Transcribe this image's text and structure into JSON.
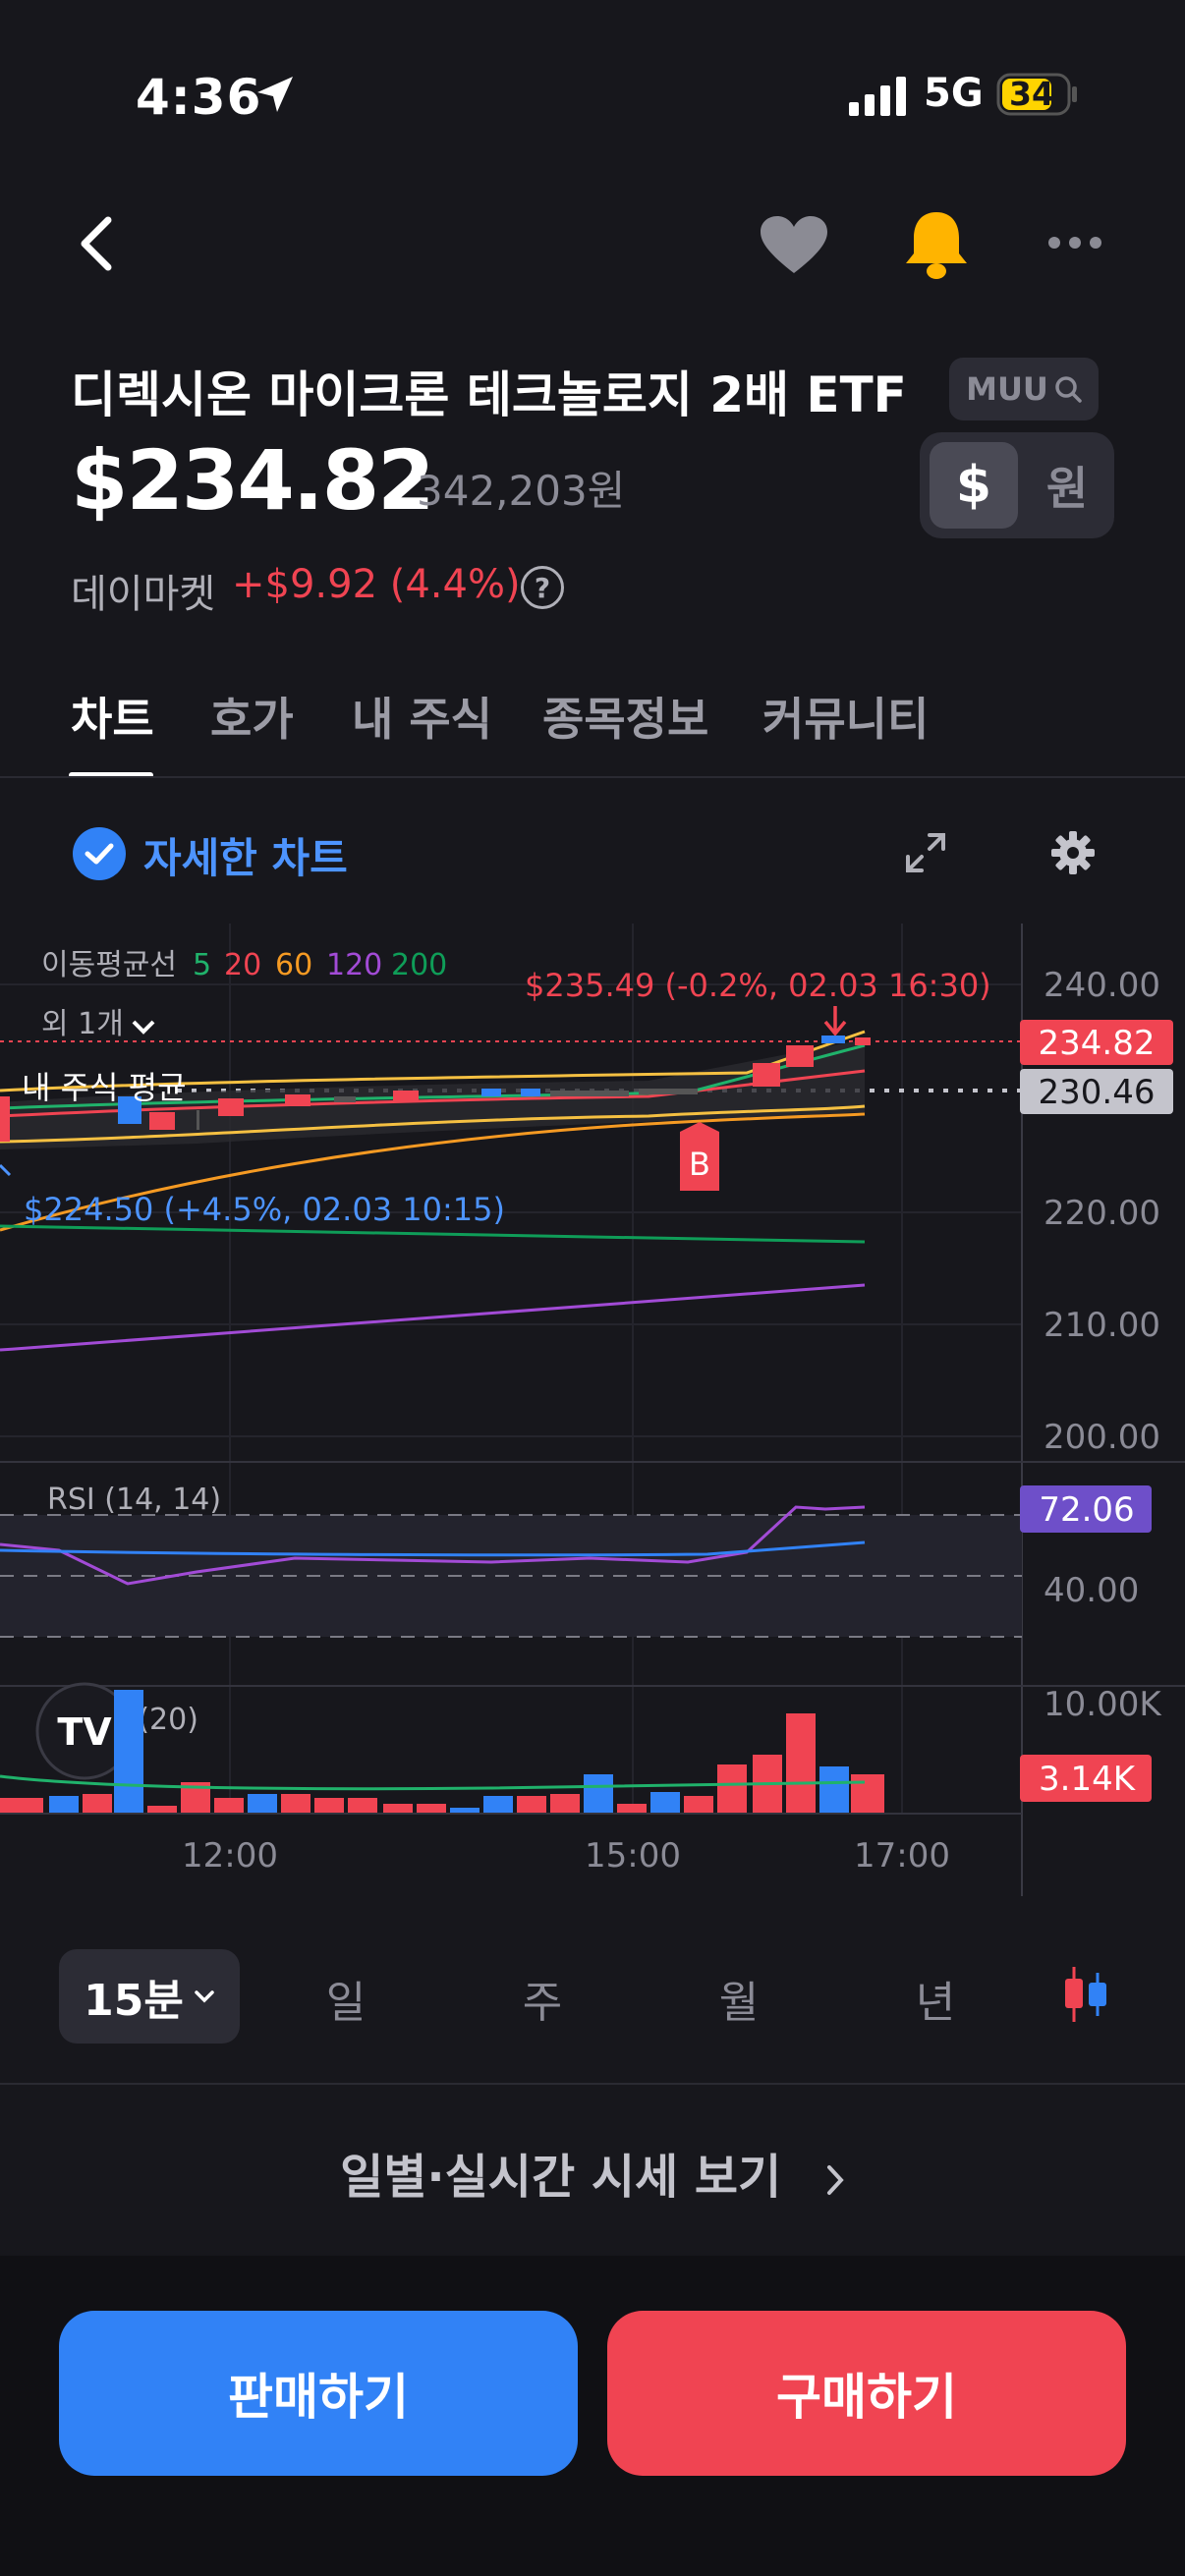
{
  "status_bar": {
    "time": "4:36",
    "network": "5G",
    "battery": "34"
  },
  "stock": {
    "name": "디렉시온 마이크론 테크놀로지 2배 ETF",
    "ticker": "MUU",
    "price": "$234.82",
    "won_price": "342,203원",
    "market_label": "데이마켓",
    "change": "+$9.92 (4.4%)",
    "help": "?"
  },
  "currency_toggle": {
    "usd": "$",
    "won": "원",
    "selected": "usd"
  },
  "tabs": [
    {
      "label": "차트",
      "active": true
    },
    {
      "label": "호가",
      "active": false
    },
    {
      "label": "내 주식",
      "active": false
    },
    {
      "label": "종목정보",
      "active": false
    },
    {
      "label": "커뮤니티",
      "active": false
    }
  ],
  "detail_chart": {
    "label": "자세한 차트",
    "checked": true
  },
  "chart": {
    "ma_label": "이동평균선",
    "ma_periods": [
      {
        "label": "5",
        "color": "#20b26b"
      },
      {
        "label": "20",
        "color": "#f04452"
      },
      {
        "label": "60",
        "color": "#f59a23"
      },
      {
        "label": "120",
        "color": "#a24bd6"
      },
      {
        "label": "200",
        "color": "#0f9d58"
      }
    ],
    "more_indicators": "외 1개",
    "high_annotation": "$235.49 (-0.2%, 02.03 16:30)",
    "low_annotation": "$224.50 (+4.5%, 02.03 10:15)",
    "avg_label": "내 주식 평균",
    "buy_marker": "B",
    "current_price_tag": "234.82",
    "avg_price_tag": "230.46",
    "rsi_label": "RSI (14, 14)",
    "rsi_value_tag": "72.06",
    "volume_label": "거래량 (20)",
    "volume_value_tag": "3.14K",
    "logo_text": "TV",
    "colors": {
      "up": "#f04452",
      "down": "#3182f6",
      "rsi_tag": "#6e4fc9"
    }
  },
  "chart_data": {
    "type": "candlestick",
    "price_axis": [
      "240.00",
      "230.00",
      "220.00",
      "210.00",
      "200.00"
    ],
    "price_range": [
      200,
      240
    ],
    "rsi_axis": [
      "80.00",
      "40.00"
    ],
    "volume_axis": [
      "10.00K"
    ],
    "x_axis": [
      "12:00",
      "15:00",
      "17:00"
    ],
    "current_price": 234.82,
    "average_price": 230.46,
    "rsi_current": 72.06,
    "volume_current": "3.14K"
  },
  "timeframes": {
    "selected": "15분",
    "options": [
      "일",
      "주",
      "월",
      "년"
    ]
  },
  "daily_link": "일별·실시간 시세 보기",
  "actions": {
    "sell": "판매하기",
    "buy": "구매하기"
  }
}
